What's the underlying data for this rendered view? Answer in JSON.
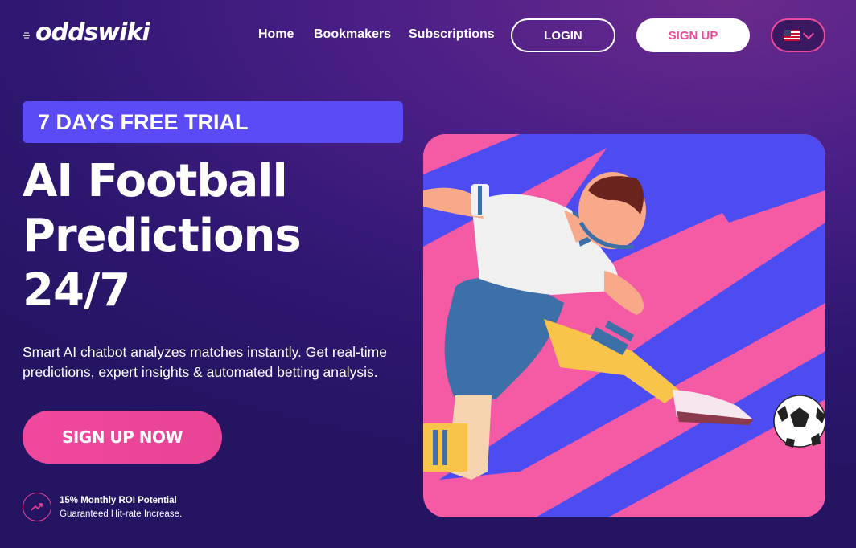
{
  "brand": {
    "logo_text": "oddswiki"
  },
  "nav": {
    "links": [
      "Home",
      "Bookmakers",
      "Subscriptions"
    ],
    "login_label": "LOGIN",
    "signup_label": "SIGN UP",
    "language": "us-flag-icon"
  },
  "hero": {
    "badge": "7 DAYS FREE TRIAL",
    "headline": [
      "AI Football",
      "Predictions",
      "24/7"
    ],
    "subtext": "Smart AI chatbot analyzes matches instantly. Get real-time predictions, expert insights & automated betting analysis.",
    "cta_label": "SIGN UP NOW",
    "roi_title": "15% Monthly ROI Potential",
    "roi_subtitle": "Guaranteed Hit-rate Increase.",
    "roi_icon": "trending-up-icon",
    "illustration": "football-player-kicking-ball"
  },
  "colors": {
    "accent_pink": "#ec4a9b",
    "badge_blue": "#5b4bf5",
    "bg_purple": "#2e1770",
    "art_blue": "#4c4cf0",
    "art_pink": "#f55aa5"
  }
}
